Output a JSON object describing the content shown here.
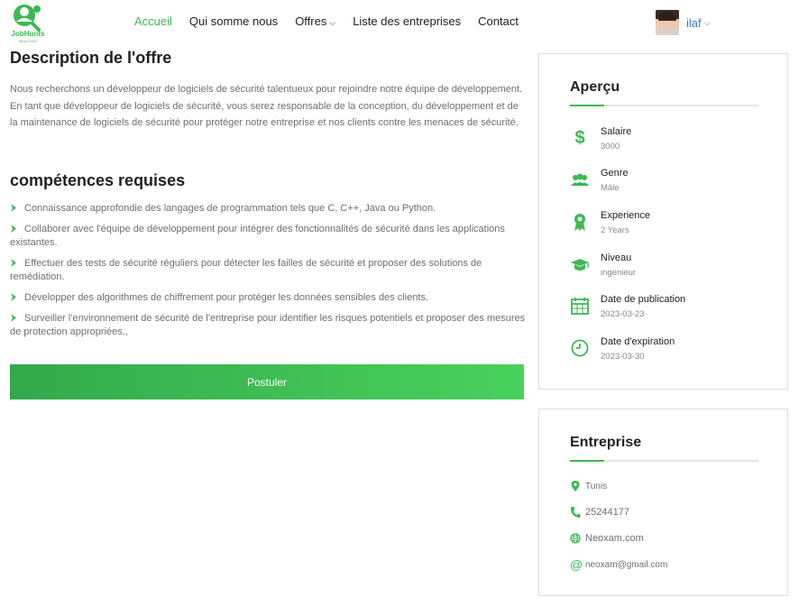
{
  "brand": {
    "name": "JobHunts",
    "tagline": "Since 2022"
  },
  "nav": {
    "items": [
      {
        "label": "Accueil",
        "active": true
      },
      {
        "label": "Qui somme nous"
      },
      {
        "label": "Offres",
        "has_dropdown": true
      },
      {
        "label": "Liste des entreprises"
      },
      {
        "label": "Contact"
      }
    ]
  },
  "user": {
    "name": "ilaf"
  },
  "description": {
    "title": "Description de l'offre",
    "text": "Nous recherchons un développeur de logiciels de sécurité talentueux pour rejoindre notre équipe de développement. En tant que développeur de logiciels de sécurité, vous serez responsable de la conception, du développement et de la maintenance de logiciels de sécurité pour protéger notre entreprise et nos clients contre les menaces de sécurité."
  },
  "skills": {
    "title": "compétences requises",
    "items": [
      "Connaissance approfondie des langages de programmation tels que C, C++, Java ou Python.",
      "Collaborer avec l'équipe de développement pour intégrer des fonctionnalités de sécurité dans les applications existantes.",
      "Effectuer des tests de sécurité réguliers pour détecter les failles de sécurité et proposer des solutions de remédiation.",
      "Développer des algorithmes de chiffrement pour protéger les données sensibles des clients.",
      "Surveiller l'environnement de sécurité de l'entreprise pour identifier les risques potentiels et proposer des mesures de protection appropriées.,"
    ]
  },
  "apply_button": "Postuler",
  "overview": {
    "title": "Aperçu",
    "items": [
      {
        "label": "Salaire",
        "value": "3000",
        "icon": "dollar-icon"
      },
      {
        "label": "Genre",
        "value": "Mâle",
        "icon": "users-icon"
      },
      {
        "label": "Experience",
        "value": "2 Years",
        "icon": "award-icon"
      },
      {
        "label": "Niveau",
        "value": "ingenieur",
        "icon": "graduation-cap-icon"
      },
      {
        "label": "Date de publication",
        "value": "2023-03-23",
        "icon": "calendar-icon"
      },
      {
        "label": "Date d'expiration",
        "value": "2023-03-30",
        "icon": "clock-icon"
      }
    ]
  },
  "company": {
    "title": "Entreprise",
    "location": "Tunis",
    "phone": "25244177",
    "website": "Neoxam.com",
    "email": "neoxam@gmail.com"
  },
  "colors": {
    "accent": "#3cb952",
    "link": "#3a74d9"
  }
}
